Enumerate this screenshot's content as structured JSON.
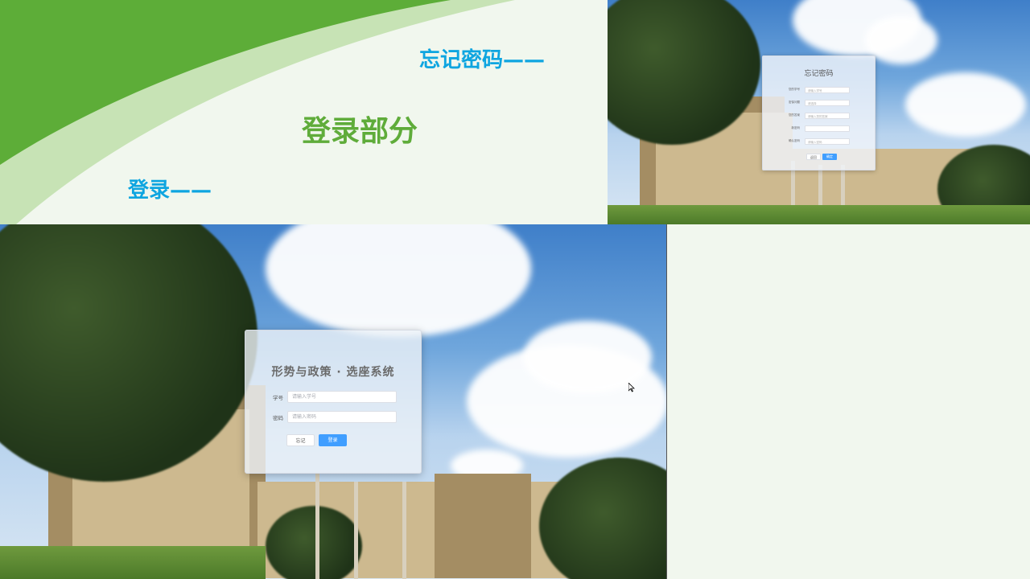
{
  "slide": {
    "section_title": "登录部分",
    "forgot_label": "忘记密码——",
    "login_label": "登录——"
  },
  "forgot_panel": {
    "title": "忘记密码",
    "fields": [
      {
        "label": "您的学号",
        "placeholder": "请输入学号"
      },
      {
        "label": "密保问题",
        "placeholder": "请选择"
      },
      {
        "label": "您的答案",
        "placeholder": "请输入您的答案"
      },
      {
        "label": "新密码",
        "placeholder": ""
      },
      {
        "label": "确认密码",
        "placeholder": "请输入密码"
      }
    ],
    "cancel_label": "返回",
    "ok_label": "确定"
  },
  "login_panel": {
    "title": "形势与政策 · 选座系统",
    "student_id_label": "学号",
    "student_id_placeholder": "请输入学号",
    "password_label": "密码",
    "password_placeholder": "请输入密码",
    "forgot_button": "忘记",
    "login_button": "登录"
  },
  "colors": {
    "accent_green": "#5fac3a",
    "accent_blue": "#0ea5e0",
    "button_primary": "#409eff"
  },
  "icons": [
    "cursor-icon"
  ]
}
